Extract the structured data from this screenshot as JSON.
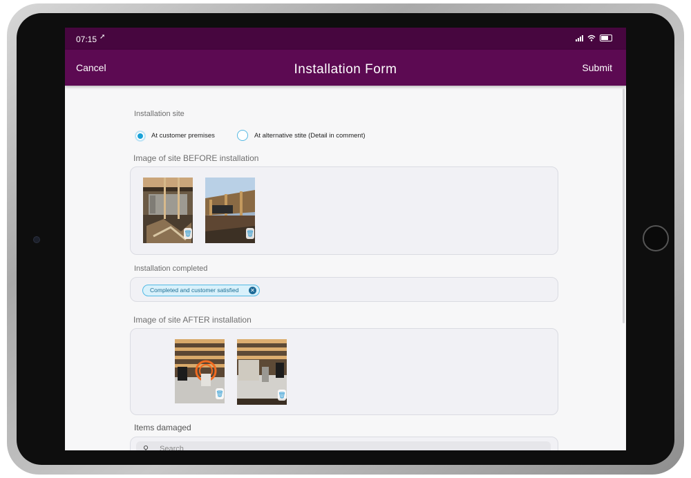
{
  "status": {
    "time": "07:15"
  },
  "header": {
    "cancel_label": "Cancel",
    "title": "Installation Form",
    "submit_label": "Submit"
  },
  "installation_site": {
    "label": "Installation site",
    "options": [
      {
        "label": "At customer premises",
        "selected": true
      },
      {
        "label": "At alternative stite (Detail in comment)",
        "selected": false
      }
    ]
  },
  "before_images": {
    "label": "Image of site BEFORE installation",
    "count": 2
  },
  "installation_completed": {
    "label": "Installation completed",
    "selected_chip": "Completed and customer satisfied"
  },
  "after_images": {
    "label": "Image of site AFTER installation",
    "count": 2
  },
  "items_damaged": {
    "label": "Items damaged",
    "search_placeholder": "Search"
  },
  "colors": {
    "header_bg": "#5c0a52",
    "status_bg": "#47063f",
    "accent": "#1aa2d8"
  },
  "icons": [
    "location-arrow-icon",
    "signal-icon",
    "wifi-icon",
    "battery-icon",
    "trash-icon",
    "close-icon",
    "search-icon"
  ]
}
